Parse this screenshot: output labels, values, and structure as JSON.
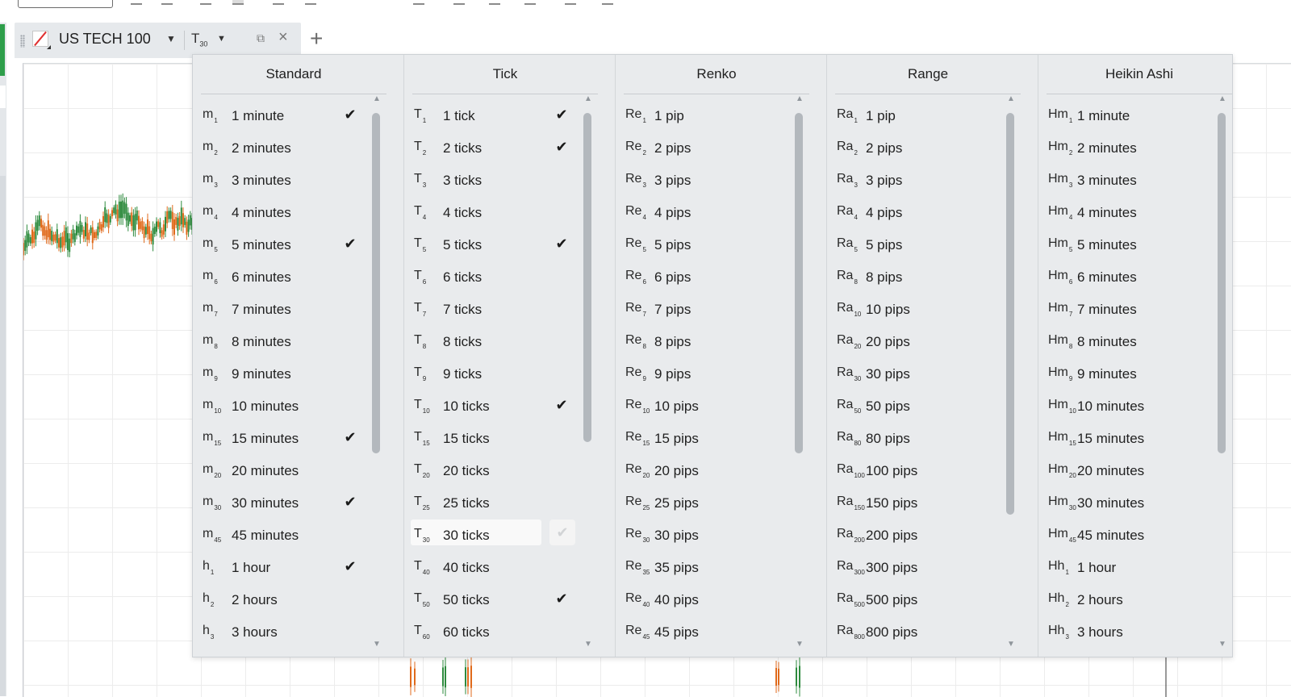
{
  "chart_tab": {
    "instrument": "US TECH 100",
    "period_symbol": "T",
    "period_sub": "30"
  },
  "menu": {
    "columns": [
      {
        "title": "Standard",
        "items": [
          {
            "sym": "m",
            "sub": "1",
            "label": "1 minute",
            "checked": true
          },
          {
            "sym": "m",
            "sub": "2",
            "label": "2 minutes",
            "checked": false
          },
          {
            "sym": "m",
            "sub": "3",
            "label": "3 minutes",
            "checked": false
          },
          {
            "sym": "m",
            "sub": "4",
            "label": "4 minutes",
            "checked": false
          },
          {
            "sym": "m",
            "sub": "5",
            "label": "5 minutes",
            "checked": true
          },
          {
            "sym": "m",
            "sub": "6",
            "label": "6 minutes",
            "checked": false
          },
          {
            "sym": "m",
            "sub": "7",
            "label": "7 minutes",
            "checked": false
          },
          {
            "sym": "m",
            "sub": "8",
            "label": "8 minutes",
            "checked": false
          },
          {
            "sym": "m",
            "sub": "9",
            "label": "9 minutes",
            "checked": false
          },
          {
            "sym": "m",
            "sub": "10",
            "label": "10 minutes",
            "checked": false
          },
          {
            "sym": "m",
            "sub": "15",
            "label": "15 minutes",
            "checked": true
          },
          {
            "sym": "m",
            "sub": "20",
            "label": "20 minutes",
            "checked": false
          },
          {
            "sym": "m",
            "sub": "30",
            "label": "30 minutes",
            "checked": true
          },
          {
            "sym": "m",
            "sub": "45",
            "label": "45 minutes",
            "checked": false
          },
          {
            "sym": "h",
            "sub": "1",
            "label": "1 hour",
            "checked": true
          },
          {
            "sym": "h",
            "sub": "2",
            "label": "2 hours",
            "checked": false
          },
          {
            "sym": "h",
            "sub": "3",
            "label": "3 hours",
            "checked": false
          }
        ]
      },
      {
        "title": "Tick",
        "items": [
          {
            "sym": "T",
            "sub": "1",
            "label": "1 tick",
            "checked": true
          },
          {
            "sym": "T",
            "sub": "2",
            "label": "2 ticks",
            "checked": true
          },
          {
            "sym": "T",
            "sub": "3",
            "label": "3 ticks",
            "checked": false
          },
          {
            "sym": "T",
            "sub": "4",
            "label": "4 ticks",
            "checked": false
          },
          {
            "sym": "T",
            "sub": "5",
            "label": "5 ticks",
            "checked": true
          },
          {
            "sym": "T",
            "sub": "6",
            "label": "6 ticks",
            "checked": false
          },
          {
            "sym": "T",
            "sub": "7",
            "label": "7 ticks",
            "checked": false
          },
          {
            "sym": "T",
            "sub": "8",
            "label": "8 ticks",
            "checked": false
          },
          {
            "sym": "T",
            "sub": "9",
            "label": "9 ticks",
            "checked": false
          },
          {
            "sym": "T",
            "sub": "10",
            "label": "10 ticks",
            "checked": true
          },
          {
            "sym": "T",
            "sub": "15",
            "label": "15 ticks",
            "checked": false
          },
          {
            "sym": "T",
            "sub": "20",
            "label": "20 ticks",
            "checked": false
          },
          {
            "sym": "T",
            "sub": "25",
            "label": "25 ticks",
            "checked": false
          },
          {
            "sym": "T",
            "sub": "30",
            "label": "30 ticks",
            "checked": false,
            "selected": true
          },
          {
            "sym": "T",
            "sub": "40",
            "label": "40 ticks",
            "checked": false
          },
          {
            "sym": "T",
            "sub": "50",
            "label": "50 ticks",
            "checked": true
          },
          {
            "sym": "T",
            "sub": "60",
            "label": "60 ticks",
            "checked": false
          }
        ]
      },
      {
        "title": "Renko",
        "items": [
          {
            "sym": "Re",
            "sub": "1",
            "label": "1 pip",
            "checked": false
          },
          {
            "sym": "Re",
            "sub": "2",
            "label": "2 pips",
            "checked": false
          },
          {
            "sym": "Re",
            "sub": "3",
            "label": "3 pips",
            "checked": false
          },
          {
            "sym": "Re",
            "sub": "4",
            "label": "4 pips",
            "checked": false
          },
          {
            "sym": "Re",
            "sub": "5",
            "label": "5 pips",
            "checked": false
          },
          {
            "sym": "Re",
            "sub": "6",
            "label": "6 pips",
            "checked": false
          },
          {
            "sym": "Re",
            "sub": "7",
            "label": "7 pips",
            "checked": false
          },
          {
            "sym": "Re",
            "sub": "8",
            "label": "8 pips",
            "checked": false
          },
          {
            "sym": "Re",
            "sub": "9",
            "label": "9 pips",
            "checked": false
          },
          {
            "sym": "Re",
            "sub": "10",
            "label": "10 pips",
            "checked": false
          },
          {
            "sym": "Re",
            "sub": "15",
            "label": "15 pips",
            "checked": false
          },
          {
            "sym": "Re",
            "sub": "20",
            "label": "20 pips",
            "checked": false
          },
          {
            "sym": "Re",
            "sub": "25",
            "label": "25 pips",
            "checked": false
          },
          {
            "sym": "Re",
            "sub": "30",
            "label": "30 pips",
            "checked": false
          },
          {
            "sym": "Re",
            "sub": "35",
            "label": "35 pips",
            "checked": false
          },
          {
            "sym": "Re",
            "sub": "40",
            "label": "40 pips",
            "checked": false
          },
          {
            "sym": "Re",
            "sub": "45",
            "label": "45 pips",
            "checked": false
          }
        ]
      },
      {
        "title": "Range",
        "items": [
          {
            "sym": "Ra",
            "sub": "1",
            "label": "1 pip",
            "checked": false
          },
          {
            "sym": "Ra",
            "sub": "2",
            "label": "2 pips",
            "checked": false
          },
          {
            "sym": "Ra",
            "sub": "3",
            "label": "3 pips",
            "checked": false
          },
          {
            "sym": "Ra",
            "sub": "4",
            "label": "4 pips",
            "checked": false
          },
          {
            "sym": "Ra",
            "sub": "5",
            "label": "5 pips",
            "checked": false
          },
          {
            "sym": "Ra",
            "sub": "8",
            "label": "8 pips",
            "checked": false
          },
          {
            "sym": "Ra",
            "sub": "10",
            "label": "10 pips",
            "checked": false
          },
          {
            "sym": "Ra",
            "sub": "20",
            "label": "20 pips",
            "checked": false
          },
          {
            "sym": "Ra",
            "sub": "30",
            "label": "30 pips",
            "checked": false
          },
          {
            "sym": "Ra",
            "sub": "50",
            "label": "50 pips",
            "checked": false
          },
          {
            "sym": "Ra",
            "sub": "80",
            "label": "80 pips",
            "checked": false
          },
          {
            "sym": "Ra",
            "sub": "100",
            "label": "100 pips",
            "checked": false
          },
          {
            "sym": "Ra",
            "sub": "150",
            "label": "150 pips",
            "checked": false
          },
          {
            "sym": "Ra",
            "sub": "200",
            "label": "200 pips",
            "checked": false
          },
          {
            "sym": "Ra",
            "sub": "300",
            "label": "300 pips",
            "checked": false
          },
          {
            "sym": "Ra",
            "sub": "500",
            "label": "500 pips",
            "checked": false
          },
          {
            "sym": "Ra",
            "sub": "800",
            "label": "800 pips",
            "checked": false
          }
        ]
      },
      {
        "title": "Heikin Ashi",
        "items": [
          {
            "sym": "Hm",
            "sub": "1",
            "label": "1 minute",
            "checked": false
          },
          {
            "sym": "Hm",
            "sub": "2",
            "label": "2 minutes",
            "checked": false
          },
          {
            "sym": "Hm",
            "sub": "3",
            "label": "3 minutes",
            "checked": false
          },
          {
            "sym": "Hm",
            "sub": "4",
            "label": "4 minutes",
            "checked": false
          },
          {
            "sym": "Hm",
            "sub": "5",
            "label": "5 minutes",
            "checked": false
          },
          {
            "sym": "Hm",
            "sub": "6",
            "label": "6 minutes",
            "checked": false
          },
          {
            "sym": "Hm",
            "sub": "7",
            "label": "7 minutes",
            "checked": false
          },
          {
            "sym": "Hm",
            "sub": "8",
            "label": "8 minutes",
            "checked": false
          },
          {
            "sym": "Hm",
            "sub": "9",
            "label": "9 minutes",
            "checked": false
          },
          {
            "sym": "Hm",
            "sub": "10",
            "label": "10 minutes",
            "checked": false
          },
          {
            "sym": "Hm",
            "sub": "15",
            "label": "15 minutes",
            "checked": false
          },
          {
            "sym": "Hm",
            "sub": "20",
            "label": "20 minutes",
            "checked": false
          },
          {
            "sym": "Hm",
            "sub": "30",
            "label": "30 minutes",
            "checked": false
          },
          {
            "sym": "Hm",
            "sub": "45",
            "label": "45 minutes",
            "checked": false
          },
          {
            "sym": "Hh",
            "sub": "1",
            "label": "1 hour",
            "checked": false
          },
          {
            "sym": "Hh",
            "sub": "2",
            "label": "2 hours",
            "checked": false
          },
          {
            "sym": "Hh",
            "sub": "3",
            "label": "3 hours",
            "checked": false
          }
        ]
      }
    ]
  },
  "colors": {
    "bull_candle": "#2e8b3e",
    "bear_candle": "#e06a1b",
    "accent_green": "#2e9e4a",
    "logo_red": "#e03030"
  },
  "icons": {
    "check": "check-icon",
    "scroll_up": "scroll-up-arrow-icon",
    "scroll_down": "scroll-down-arrow-icon"
  }
}
